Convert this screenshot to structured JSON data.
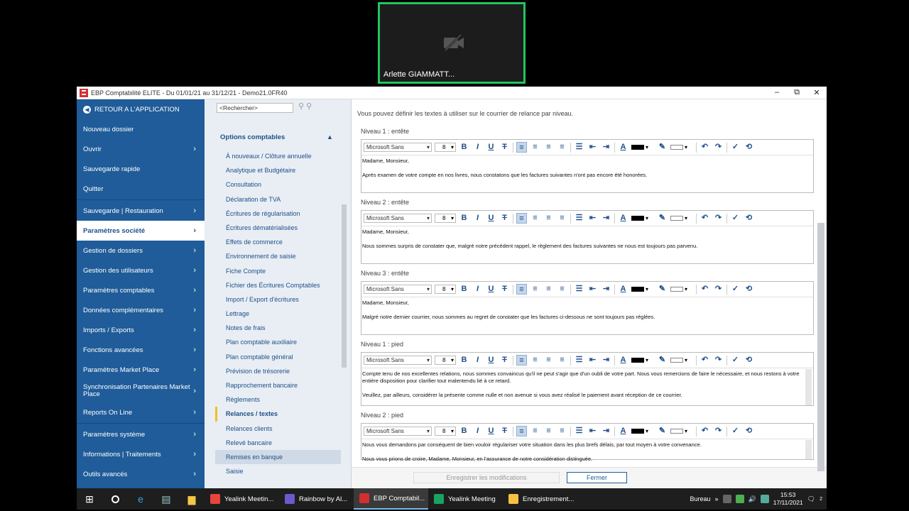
{
  "meeting": {
    "participant_name": "Arlette GIAMMATT..."
  },
  "window": {
    "title": "EBP Comptabilité ELITE - Du 01/01/21 au 31/12/21 - Demo21.0FR40",
    "minimize": "–",
    "maximize": "⧉",
    "close": "✕"
  },
  "sidebar": {
    "back": "RETOUR A L'APPLICATION",
    "items": [
      {
        "label": "Nouveau dossier",
        "chevron": ""
      },
      {
        "label": "Ouvrir",
        "chevron": "›"
      },
      {
        "label": "Sauvegarde rapide",
        "chevron": ""
      },
      {
        "label": "Quitter",
        "chevron": ""
      },
      {
        "label": "Sauvegarde | Restauration",
        "chevron": "›"
      },
      {
        "label": "Paramètres société",
        "chevron": "›"
      },
      {
        "label": "Gestion de dossiers",
        "chevron": "›"
      },
      {
        "label": "Gestion des utilisateurs",
        "chevron": "›"
      },
      {
        "label": "Paramètres comptables",
        "chevron": "›"
      },
      {
        "label": "Données complémentaires",
        "chevron": "›"
      },
      {
        "label": "Imports / Exports",
        "chevron": "›"
      },
      {
        "label": "Fonctions avancées",
        "chevron": "›"
      },
      {
        "label": "Paramètres Market Place",
        "chevron": "›"
      },
      {
        "label": "Synchronisation Partenaires Market Place",
        "chevron": "›"
      },
      {
        "label": "Reports On Line",
        "chevron": "›"
      },
      {
        "label": "Paramètres système",
        "chevron": "›"
      },
      {
        "label": "Informations | Traitements",
        "chevron": "›"
      },
      {
        "label": "Outils avancés",
        "chevron": "›"
      }
    ]
  },
  "nav": {
    "search_placeholder": "<Rechercher>",
    "heading": "Options comptables",
    "items": [
      "À nouveaux / Clôture annuelle",
      "Analytique et Budgétaire",
      "Consultation",
      "Déclaration de TVA",
      "Écritures de régularisation",
      "Écritures dématérialisées",
      "Effets de commerce",
      "Environnement de saisie",
      "Fiche Compte",
      "Fichier des Écritures Comptables",
      "Import / Export d'écritures",
      "Lettrage",
      "Notes de frais",
      "Plan comptable auxiliaire",
      "Plan comptable général",
      "Prévision de trésorerie",
      "Rapprochement bancaire",
      "Règlements",
      "Relances / textes",
      "Relances clients",
      "Relevé bancaire",
      "Remises en banque",
      "Saisie"
    ],
    "selected_index": 18,
    "hover_index": 21
  },
  "content": {
    "intro": "Vous pouvez définir les textes à utiliser sur le courrier de relance par niveau.",
    "font": "Microsoft Sans",
    "size": "8",
    "sections": [
      {
        "label": "Niveau 1 : entête",
        "lines": [
          "Madame, Monsieur,",
          "Après examen de votre compte en nos livres, nous constatons que les factures suivantes n'ont pas encore été honorées."
        ]
      },
      {
        "label": "Niveau 2 : entête",
        "lines": [
          "Madame, Monsieur,",
          "Nous sommes surpris de constater que, malgré notre précédent rappel, le règlement des factures suivantes ne nous est toujours pas parvenu."
        ]
      },
      {
        "label": "Niveau 3 : entête",
        "lines": [
          "Madame, Monsieur,",
          "Malgré notre dernier courrier, nous sommes au regret de constater que les factures ci-dessous ne sont toujours pas réglées."
        ]
      },
      {
        "label": "Niveau 1 : pied",
        "lines": [
          "Compte tenu de nos excellentes relations, nous sommes convaincus qu'il ne peut s'agir que d'un oubli de votre part. Nous vous remercions de faire le nécessaire, et nous restons à votre entière disposition pour clarifier tout malentendu lié à ce retard.",
          "Veuillez, par ailleurs, considérer la présente comme nulle et non avenue si vous avez réalisé le paiement avant réception de ce courrier."
        ]
      },
      {
        "label": "Niveau 2 : pied",
        "lines": [
          "Nous vous demandons par conséquent de bien vouloir régulariser votre situation dans les plus brefs délais, par tout moyen à votre convenance.",
          "Nous vous prions de croire, Madame, Monsieur, en l'assurance de notre considération distinguée."
        ]
      }
    ],
    "save_label": "Enregistrer les modifications",
    "close_label": "Fermer"
  },
  "taskbar": {
    "tasks": [
      {
        "label": "Yealink Meetin...",
        "color": "#e8453c"
      },
      {
        "label": "Rainbow by Al...",
        "color": "#6a5acd"
      },
      {
        "label": "EBP Comptabil...",
        "color": "#d32f2f"
      },
      {
        "label": "Yealink Meeting",
        "color": "#1aa260"
      },
      {
        "label": "Enregistrement...",
        "color": "#f5c242"
      }
    ],
    "bureau": "Bureau",
    "time": "15:53",
    "date": "17/11/2021",
    "notif_count": "2"
  }
}
